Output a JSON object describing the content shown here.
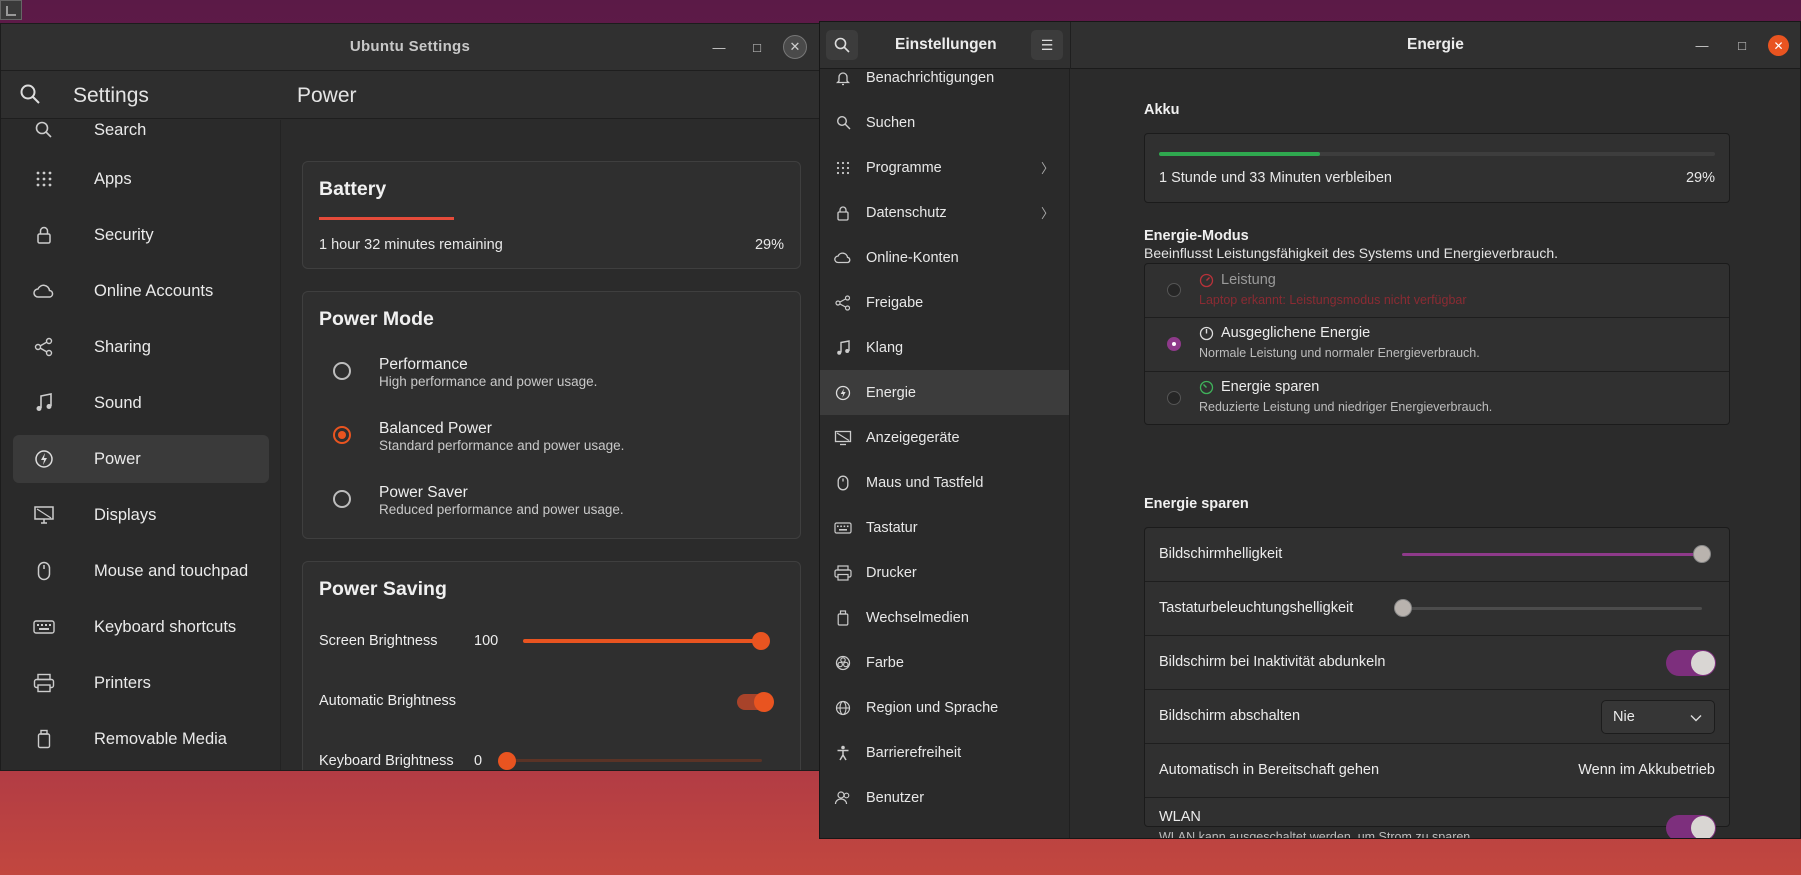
{
  "left_window": {
    "title": "Ubuntu Settings",
    "header": {
      "app_title": "Settings",
      "page_title": "Power"
    },
    "sidebar": [
      {
        "label": "Search",
        "icon": "search-icon"
      },
      {
        "label": "Apps",
        "icon": "apps-grid-icon"
      },
      {
        "label": "Security",
        "icon": "lock-icon"
      },
      {
        "label": "Online Accounts",
        "icon": "cloud-icon"
      },
      {
        "label": "Sharing",
        "icon": "share-icon"
      },
      {
        "label": "Sound",
        "icon": "music-note-icon"
      },
      {
        "label": "Power",
        "icon": "power-icon",
        "active": true
      },
      {
        "label": "Displays",
        "icon": "display-icon"
      },
      {
        "label": "Mouse and touchpad",
        "icon": "mouse-icon"
      },
      {
        "label": "Keyboard shortcuts",
        "icon": "keyboard-icon"
      },
      {
        "label": "Printers",
        "icon": "printer-icon"
      },
      {
        "label": "Removable Media",
        "icon": "removable-media-icon"
      }
    ],
    "battery": {
      "title": "Battery",
      "remaining": "1 hour 32 minutes remaining",
      "percent": "29%",
      "level": 0.29
    },
    "power_mode": {
      "title": "Power Mode",
      "options": [
        {
          "label": "Performance",
          "desc": "High performance and power usage.",
          "selected": false
        },
        {
          "label": "Balanced Power",
          "desc": "Standard performance and power usage.",
          "selected": true
        },
        {
          "label": "Power Saver",
          "desc": "Reduced performance and power usage.",
          "selected": false
        }
      ]
    },
    "power_saving": {
      "title": "Power Saving",
      "screen_brightness_label": "Screen Brightness",
      "screen_brightness_value": "100",
      "automatic_brightness_label": "Automatic Brightness",
      "automatic_brightness_on": true,
      "keyboard_brightness_label": "Keyboard Brightness",
      "keyboard_brightness_value": "0"
    },
    "accent_color": "#e95420"
  },
  "right_window": {
    "sidebar_title": "Einstellungen",
    "page_title": "Energie",
    "sidebar": [
      {
        "label": "Benachrichtigungen",
        "icon": "bell-icon"
      },
      {
        "label": "Suchen",
        "icon": "search-icon"
      },
      {
        "label": "Programme",
        "icon": "apps-grid-icon",
        "chevron": "〉"
      },
      {
        "label": "Datenschutz",
        "icon": "lock-icon",
        "chevron": "〉"
      },
      {
        "label": "Online-Konten",
        "icon": "cloud-icon"
      },
      {
        "label": "Freigabe",
        "icon": "share-icon"
      },
      {
        "label": "Klang",
        "icon": "music-note-icon"
      },
      {
        "label": "Energie",
        "icon": "power-icon",
        "active": true
      },
      {
        "label": "Anzeigegeräte",
        "icon": "display-icon"
      },
      {
        "label": "Maus und Tastfeld",
        "icon": "mouse-icon"
      },
      {
        "label": "Tastatur",
        "icon": "keyboard-icon"
      },
      {
        "label": "Drucker",
        "icon": "printer-icon"
      },
      {
        "label": "Wechselmedien",
        "icon": "removable-media-icon"
      },
      {
        "label": "Farbe",
        "icon": "color-icon"
      },
      {
        "label": "Region und Sprache",
        "icon": "globe-icon"
      },
      {
        "label": "Barrierefreiheit",
        "icon": "accessibility-icon"
      },
      {
        "label": "Benutzer",
        "icon": "users-icon"
      }
    ],
    "akku": {
      "title": "Akku",
      "remaining": "1 Stunde und 33 Minuten verbleiben",
      "percent": "29%",
      "level": 0.29
    },
    "energie_modus": {
      "title": "Energie-Modus",
      "subtitle": "Beeinflusst Leistungsfähigkeit des Systems und Energieverbrauch.",
      "options": [
        {
          "label": "Leistung",
          "desc": "Laptop erkannt: Leistungsmodus nicht verfügbar",
          "selected": false,
          "disabled": true
        },
        {
          "label": "Ausgeglichene Energie",
          "desc": "Normale Leistung und normaler Energieverbrauch.",
          "selected": true
        },
        {
          "label": "Energie sparen",
          "desc": "Reduzierte Leistung und niedriger Energieverbrauch.",
          "selected": false
        }
      ]
    },
    "energie_sparen": {
      "title": "Energie sparen",
      "screen_brightness": "Bildschirmhelligkeit",
      "screen_brightness_level": 1.0,
      "kbd_brightness": "Tastaturbeleuchtungshelligkeit",
      "kbd_brightness_level": 0.0,
      "dim_screen": "Bildschirm bei Inaktivität abdunkeln",
      "dim_screen_on": true,
      "blank_screen": "Bildschirm abschalten",
      "blank_screen_value": "Nie",
      "auto_suspend": "Automatisch in Bereitschaft gehen",
      "auto_suspend_value": "Wenn im Akkubetrieb",
      "wlan": "WLAN",
      "wlan_desc": "WLAN kann ausgeschaltet werden, um Strom zu sparen.",
      "wlan_on": true
    },
    "accent_color": "#8e3a8a"
  }
}
